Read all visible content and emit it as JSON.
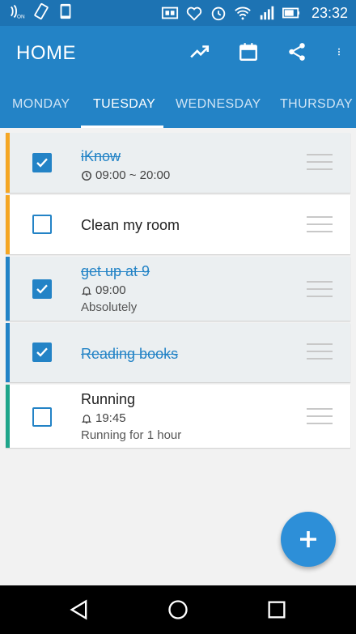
{
  "status_bar": {
    "time": "23:32",
    "icons": [
      "nfc-on-icon",
      "vibrate-icon",
      "phone-icon",
      "cast-icon",
      "heart-icon",
      "alarm-icon",
      "wifi-icon",
      "signal-icon",
      "battery-icon"
    ]
  },
  "app_bar": {
    "title": "HOME",
    "actions": [
      "trending-up-icon",
      "calendar-icon",
      "share-icon",
      "more-vert-icon"
    ]
  },
  "tabs": [
    {
      "label": "MONDAY"
    },
    {
      "label": "TUESDAY"
    },
    {
      "label": "WEDNESDAY"
    },
    {
      "label": "THURSDAY"
    }
  ],
  "active_tab": "TUESDAY",
  "tasks": [
    {
      "title": "iKnow",
      "time": "09:00 ~ 20:00",
      "time_icon": "clock-icon",
      "note": "",
      "done": true,
      "color": "#f5a623"
    },
    {
      "title": "Clean my room",
      "time": "",
      "time_icon": "",
      "note": "",
      "done": false,
      "color": "#f5a623"
    },
    {
      "title": "get up at 9",
      "time": "09:00",
      "time_icon": "bell-icon",
      "note": "Absolutely",
      "done": true,
      "color": "#2383c6"
    },
    {
      "title": "Reading books",
      "time": "",
      "time_icon": "",
      "note": "",
      "done": true,
      "color": "#2383c6"
    },
    {
      "title": "Running",
      "time": "19:45",
      "time_icon": "bell-icon",
      "note": "Running for 1 hour",
      "done": false,
      "color": "#1fa58a"
    }
  ],
  "fab": {
    "icon": "add-icon"
  },
  "colors": {
    "primary": "#2383c6",
    "status_bar": "#1d73b3",
    "accent": "#2d8fd8"
  },
  "nav_bar": [
    "back-icon",
    "home-icon",
    "recents-icon"
  ]
}
